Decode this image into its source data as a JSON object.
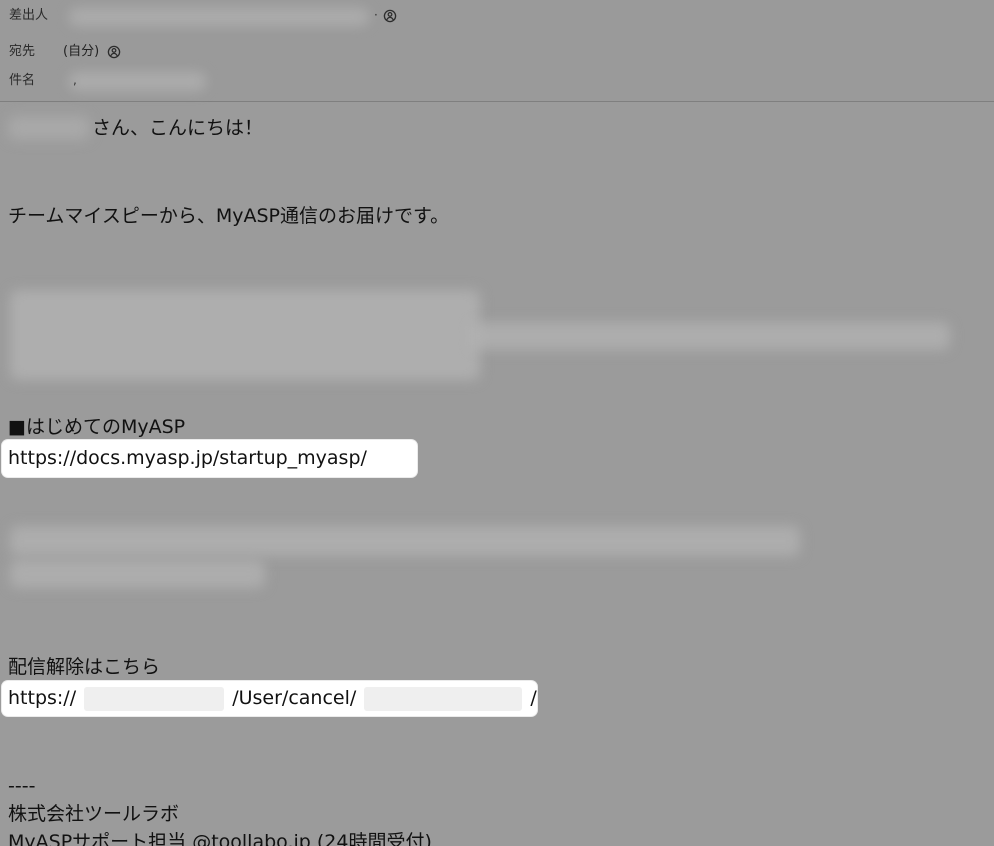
{
  "header": {
    "from_label": "差出人",
    "to_label": "宛先",
    "to_value": "(自分)",
    "subject_label": "件名"
  },
  "body": {
    "greeting": "さん、こんにちは！",
    "intro": "チームマイスピーから、MyASP通信のお届けです。",
    "section1_title": "■はじめてのMyASP",
    "section1_link": "https://docs.myasp.jp/startup_myasp/",
    "unsubscribe_title": "配信解除はこちら",
    "unsubscribe_prefix": "https://",
    "unsubscribe_middle": "/User/cancel/",
    "unsubscribe_suffix": "/",
    "signature_dash": "----",
    "signature_company": "株式会社ツールラボ",
    "signature_partial": "MyASPサポート担当 @toollabo.jp (24時間受付)"
  },
  "icons": {
    "from_avatar": "person-circle-icon",
    "to_avatar": "person-circle-icon"
  }
}
